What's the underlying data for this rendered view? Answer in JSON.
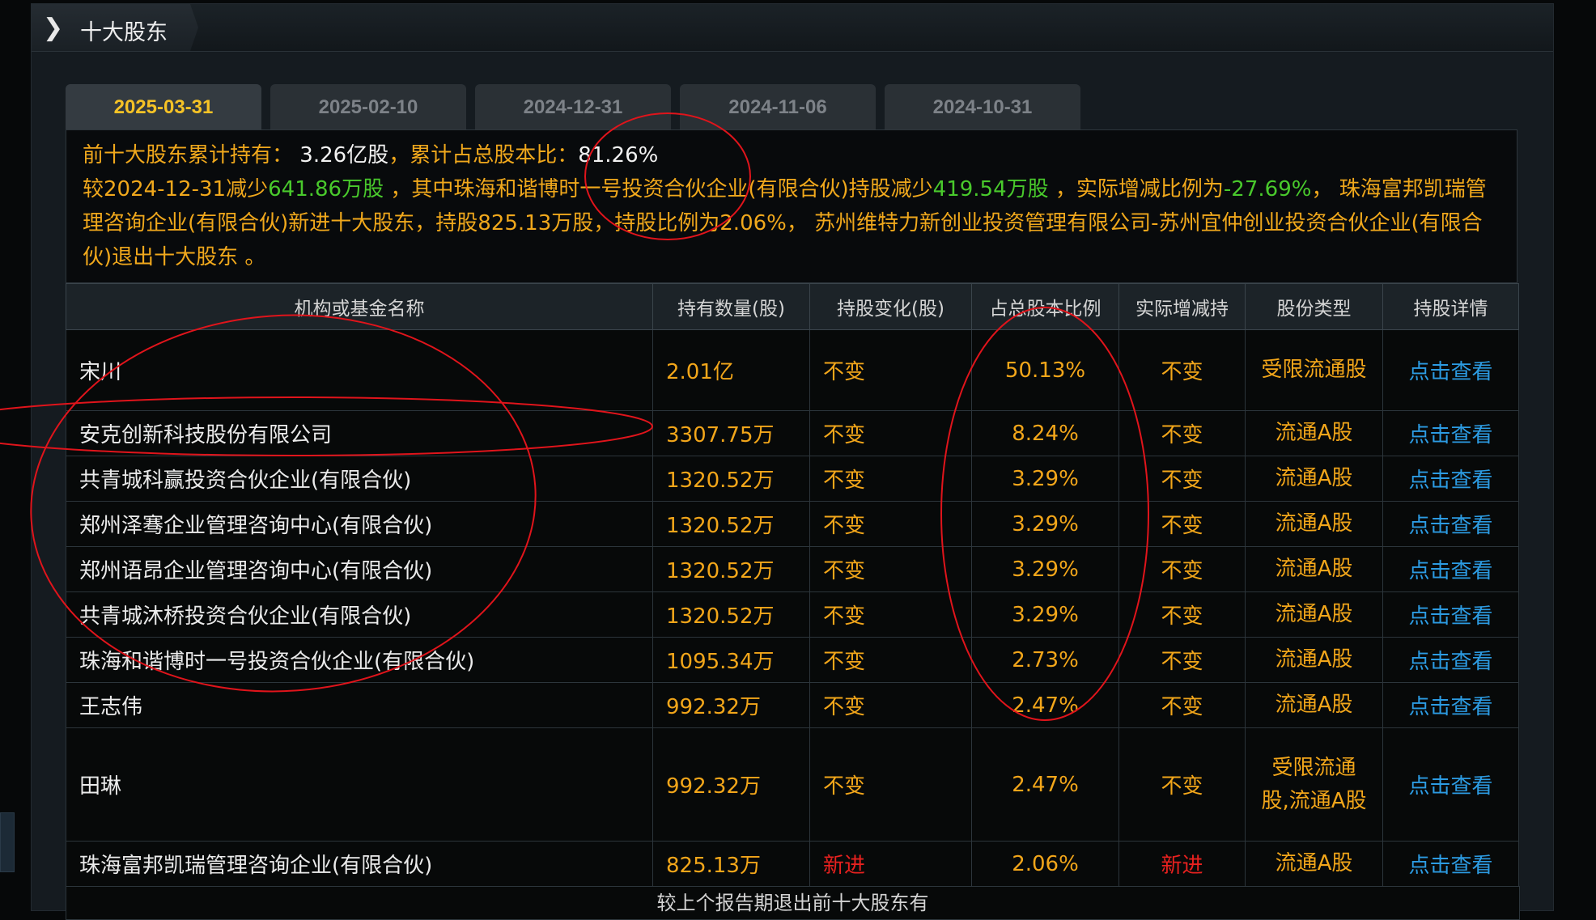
{
  "section": {
    "title": "十大股东"
  },
  "tabs": [
    "2025-03-31",
    "2025-02-10",
    "2024-12-31",
    "2024-11-06",
    "2024-10-31"
  ],
  "summary": {
    "line1_label_a": "前十大股东累计持有：",
    "total_shares": "3.26亿股",
    "line1_label_b": "，累计占总股本比：",
    "total_ratio": "81.26%",
    "line2_prefix": "较2024-12-31减少",
    "decrease": "641.86万股",
    "line2_mid": "，其中珠海和谐博时一号投资合伙企业(有限合伙)持股减少",
    "decrease2": "419.54万股",
    "line2_mid2": "，实际增减比例为",
    "decrease_ratio": "-27.69%",
    "line2_rest": "， 珠海富邦凯瑞管理咨询企业(有限合伙)新进十大股东，持股825.13万股，持股比例为2.06%， 苏州维特力新创业投资管理有限公司-苏州宜仲创业投资合伙企业(有限合伙)退出十大股东 。"
  },
  "table": {
    "headers": [
      "机构或基金名称",
      "持有数量(股)",
      "持股变化(股)",
      "占总股本比例",
      "实际增减持",
      "股份类型",
      "持股详情"
    ],
    "rows": [
      {
        "name": "宋川",
        "shares": "2.01亿",
        "change": "不变",
        "ratio": "50.13%",
        "actual": "不变",
        "type": "受限流通股",
        "detail": "点击查看"
      },
      {
        "name": "安克创新科技股份有限公司",
        "shares": "3307.75万",
        "change": "不变",
        "ratio": "8.24%",
        "actual": "不变",
        "type": "流通A股",
        "detail": "点击查看"
      },
      {
        "name": "共青城科赢投资合伙企业(有限合伙)",
        "shares": "1320.52万",
        "change": "不变",
        "ratio": "3.29%",
        "actual": "不变",
        "type": "流通A股",
        "detail": "点击查看"
      },
      {
        "name": "郑州泽骞企业管理咨询中心(有限合伙)",
        "shares": "1320.52万",
        "change": "不变",
        "ratio": "3.29%",
        "actual": "不变",
        "type": "流通A股",
        "detail": "点击查看"
      },
      {
        "name": "郑州语昂企业管理咨询中心(有限合伙)",
        "shares": "1320.52万",
        "change": "不变",
        "ratio": "3.29%",
        "actual": "不变",
        "type": "流通A股",
        "detail": "点击查看"
      },
      {
        "name": "共青城沐桥投资合伙企业(有限合伙)",
        "shares": "1320.52万",
        "change": "不变",
        "ratio": "3.29%",
        "actual": "不变",
        "type": "流通A股",
        "detail": "点击查看"
      },
      {
        "name": "珠海和谐博时一号投资合伙企业(有限合伙)",
        "shares": "1095.34万",
        "change": "不变",
        "ratio": "2.73%",
        "actual": "不变",
        "type": "流通A股",
        "detail": "点击查看"
      },
      {
        "name": "王志伟",
        "shares": "992.32万",
        "change": "不变",
        "ratio": "2.47%",
        "actual": "不变",
        "type": "流通A股",
        "detail": "点击查看"
      },
      {
        "name": "田琳",
        "shares": "992.32万",
        "change": "不变",
        "ratio": "2.47%",
        "actual": "不变",
        "type": "受限流通股,流通A股",
        "detail": "点击查看"
      },
      {
        "name": "珠海富邦凯瑞管理咨询企业(有限合伙)",
        "shares": "825.13万",
        "change": "新进",
        "ratio": "2.06%",
        "actual": "新进",
        "type": "流通A股",
        "detail": "点击查看"
      }
    ],
    "footnote": "较上个报告期退出前十大股东有"
  },
  "colors": {
    "accent": "#f0a81c",
    "increase_green": "#49c92c",
    "new_red": "#e8211f",
    "link_blue": "#2c9be2",
    "annotation_red": "#e0141b"
  }
}
